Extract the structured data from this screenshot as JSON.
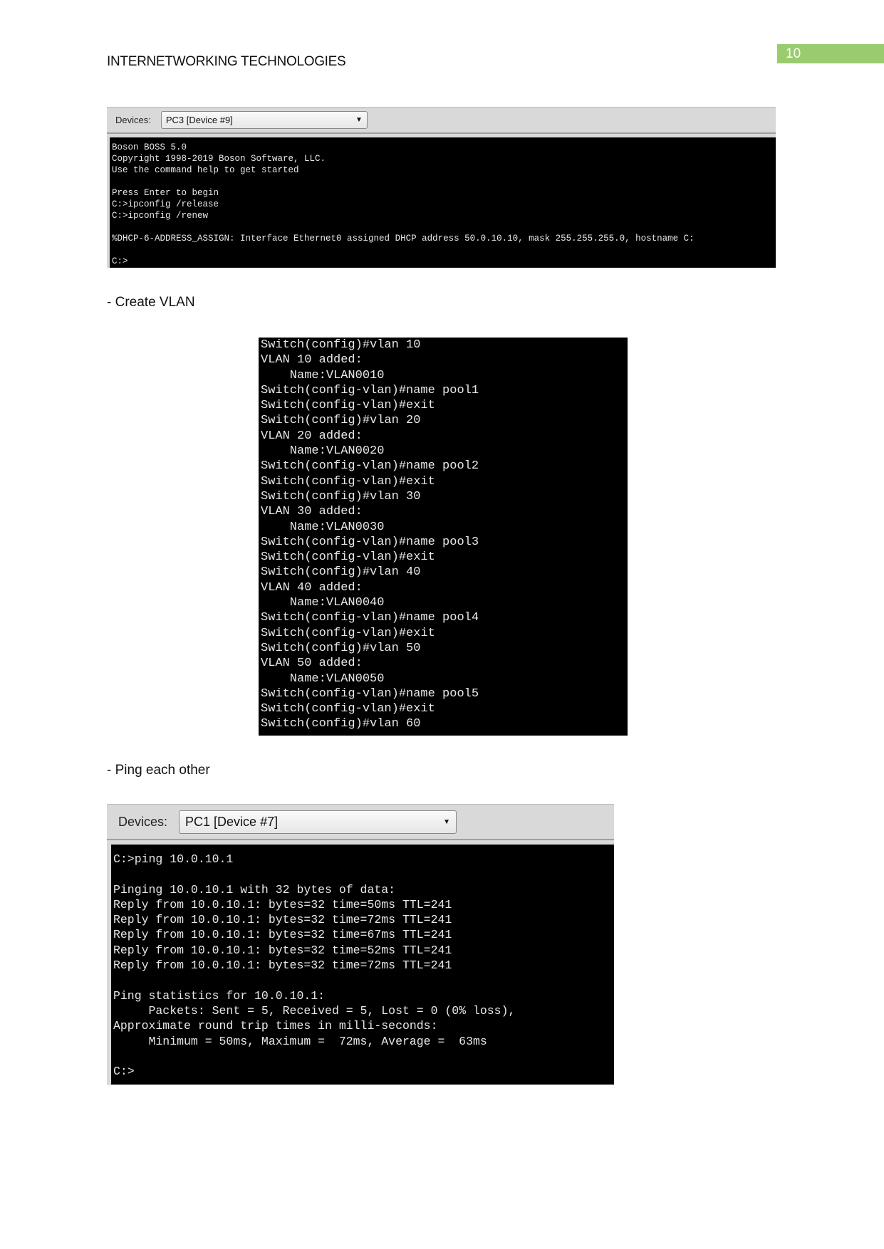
{
  "header": {
    "title": "INTERNETWORKING TECHNOLOGIES",
    "page_number": "10",
    "page_number_color": "#9bcb6f"
  },
  "screenshot1": {
    "devices_label": "Devices:",
    "device_selected": "PC3 [Device #9]",
    "terminal": "Boson BOSS 5.0\nCopyright 1998-2019 Boson Software, LLC.\nUse the command help to get started\n\nPress Enter to begin\nC:>ipconfig /release\nC:>ipconfig /renew\n\n%DHCP-6-ADDRESS_ASSIGN: Interface Ethernet0 assigned DHCP address 50.0.10.10, mask 255.255.255.0, hostname C:\n\nC:>"
  },
  "section1": "- Create VLAN",
  "screenshot2": {
    "terminal": "Switch(config)#vlan 10\nVLAN 10 added:\n    Name:VLAN0010\nSwitch(config-vlan)#name pool1\nSwitch(config-vlan)#exit\nSwitch(config)#vlan 20\nVLAN 20 added:\n    Name:VLAN0020\nSwitch(config-vlan)#name pool2\nSwitch(config-vlan)#exit\nSwitch(config)#vlan 30\nVLAN 30 added:\n    Name:VLAN0030\nSwitch(config-vlan)#name pool3\nSwitch(config-vlan)#exit\nSwitch(config)#vlan 40\nVLAN 40 added:\n    Name:VLAN0040\nSwitch(config-vlan)#name pool4\nSwitch(config-vlan)#exit\nSwitch(config)#vlan 50\nVLAN 50 added:\n    Name:VLAN0050\nSwitch(config-vlan)#name pool5\nSwitch(config-vlan)#exit\nSwitch(config)#vlan 60"
  },
  "section2": "- Ping each other",
  "screenshot3": {
    "devices_label": "Devices:",
    "device_selected": "PC1 [Device #7]",
    "terminal": "C:>ping 10.0.10.1\n\nPinging 10.0.10.1 with 32 bytes of data:\nReply from 10.0.10.1: bytes=32 time=50ms TTL=241\nReply from 10.0.10.1: bytes=32 time=72ms TTL=241\nReply from 10.0.10.1: bytes=32 time=67ms TTL=241\nReply from 10.0.10.1: bytes=32 time=52ms TTL=241\nReply from 10.0.10.1: bytes=32 time=72ms TTL=241\n\nPing statistics for 10.0.10.1:\n     Packets: Sent = 5, Received = 5, Lost = 0 (0% loss),\nApproximate round trip times in milli-seconds:\n     Minimum = 50ms, Maximum =  72ms, Average =  63ms\n\nC:>"
  }
}
